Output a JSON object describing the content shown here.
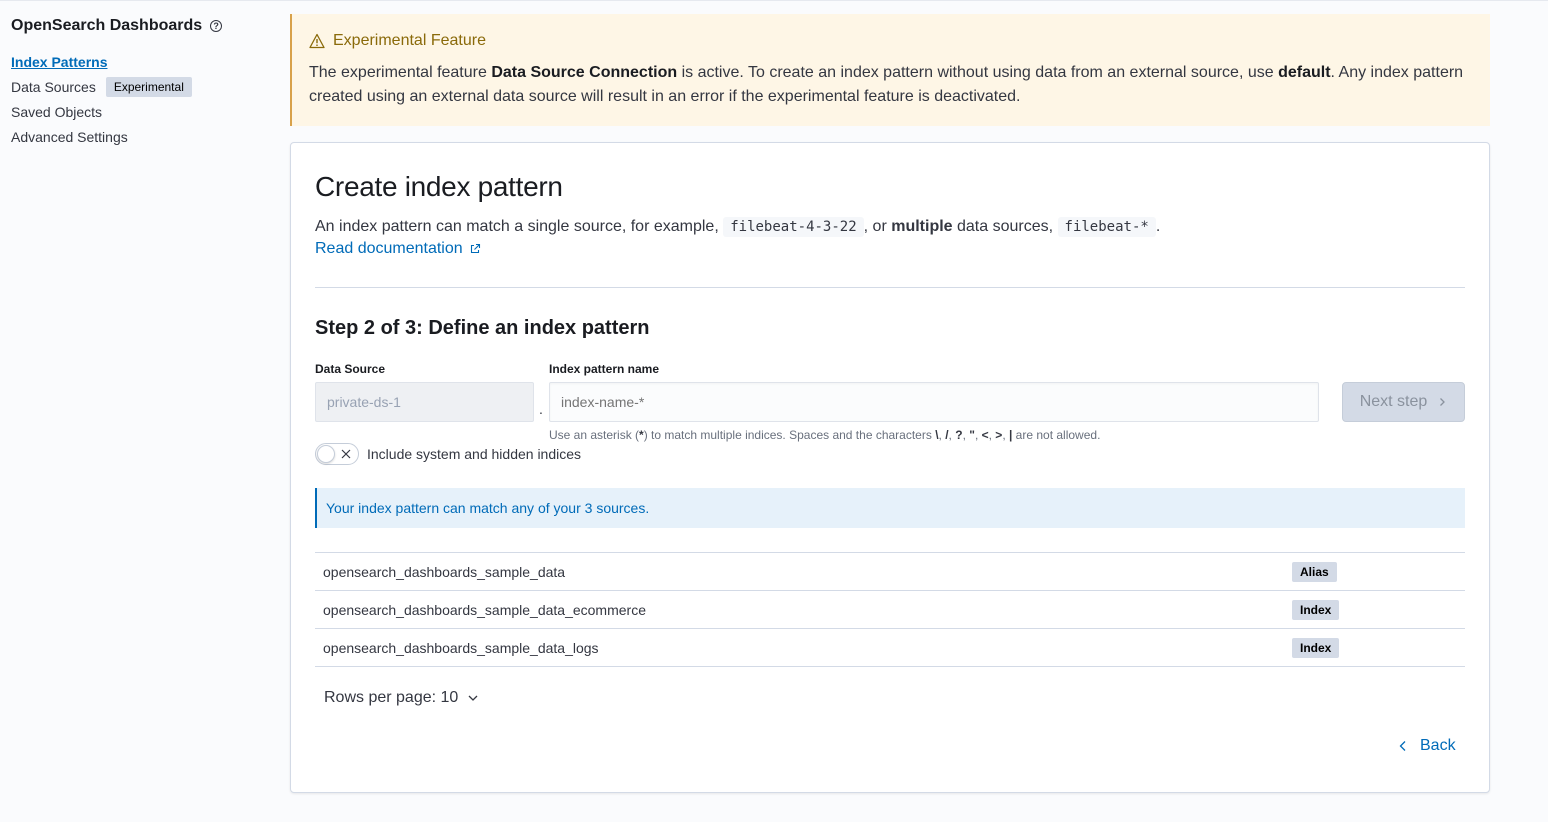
{
  "sidebar": {
    "title": "OpenSearch Dashboards",
    "help_icon": "help-icon",
    "items": [
      {
        "label": "Index Patterns",
        "active": true
      },
      {
        "label": "Data Sources",
        "badge": "Experimental"
      },
      {
        "label": "Saved Objects"
      },
      {
        "label": "Advanced Settings"
      }
    ]
  },
  "callout": {
    "icon": "warning-icon",
    "title": "Experimental Feature",
    "body_1": "The experimental feature ",
    "body_bold_1": "Data Source Connection",
    "body_2": " is active. To create an index pattern without using data from an external source, use ",
    "body_bold_2": "default",
    "body_3": ". Any index pattern created using an external data source will result in an error if the experimental feature is deactivated."
  },
  "main": {
    "title": "Create index pattern",
    "desc_1": "An index pattern can match a single source, for example, ",
    "desc_code_1": "filebeat-4-3-22",
    "desc_2": ", or ",
    "desc_bold": "multiple",
    "desc_3": " data sources, ",
    "desc_code_2": "filebeat-*",
    "desc_4": ".",
    "doc_link": "Read documentation",
    "step_title": "Step 2 of 3: Define an index pattern",
    "data_source_label": "Data Source",
    "data_source_value": "private-ds-1",
    "separator": ".",
    "index_pattern_label": "Index pattern name",
    "index_pattern_placeholder": "index-name-*",
    "help_1": "Use an asterisk (",
    "help_b1": "*",
    "help_2": ") to match multiple indices. Spaces and the characters ",
    "help_b2": "\\",
    "help_b3": "/",
    "help_b4": "?",
    "help_b5": "\"",
    "help_b6": "<",
    "help_b7": ">",
    "help_b8": "|",
    "help_comma": ", ",
    "help_3": " are not allowed.",
    "next_button": "Next step",
    "toggle_label": "Include system and hidden indices",
    "toggle_on": false,
    "info_text": "Your index pattern can match any of your 3 sources.",
    "rows": [
      {
        "name": "opensearch_dashboards_sample_data",
        "type": "Alias"
      },
      {
        "name": "opensearch_dashboards_sample_data_ecommerce",
        "type": "Index"
      },
      {
        "name": "opensearch_dashboards_sample_data_logs",
        "type": "Index"
      }
    ],
    "rows_per_page": "Rows per page: 10",
    "back_button": "Back"
  },
  "colors": {
    "accent": "#006bb8",
    "warning_bg": "#fef6e6",
    "warning_text": "#8a6a0a",
    "info_bg": "#e6f1fa"
  }
}
